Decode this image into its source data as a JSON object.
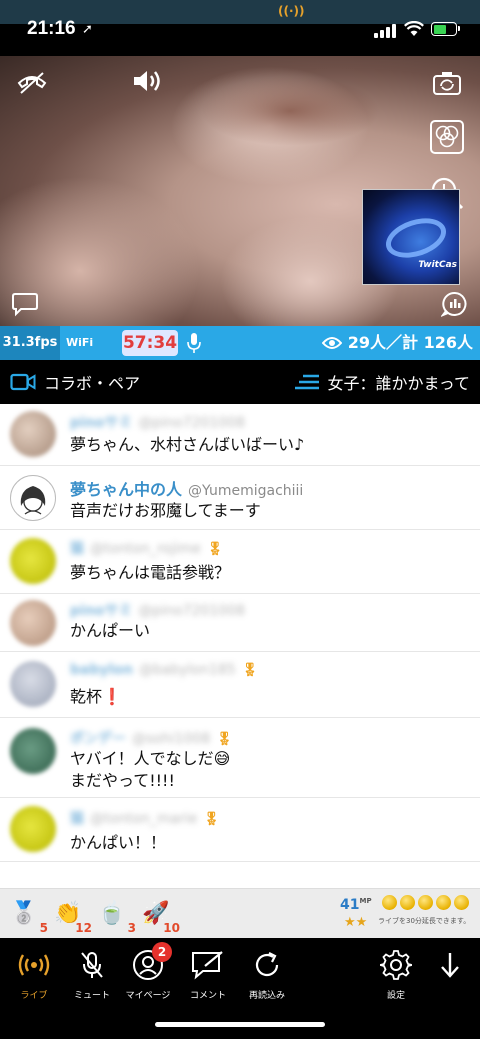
{
  "status_bar": {
    "time": "21:16",
    "location_icon": "location-arrow-icon",
    "live_indicator_icon": "broadcast-icon",
    "battery_color": "#39d353"
  },
  "video": {
    "icons": [
      "hangup-phone-icon",
      "speaker-icon",
      "camera-switch-icon",
      "filter-icon",
      "zoom-in-icon",
      "comment-toggle-icon",
      "stats-icon"
    ],
    "pip_brand": "TwitCas"
  },
  "info_bar": {
    "fps": "31.3fps",
    "network": "WiFi",
    "elapsed": "57:34",
    "viewers": "29人／計 126人",
    "accent": "#2aa8e6"
  },
  "tool_row": {
    "collab_label": "コラボ・ペア",
    "topic": "女子：誰かかまって"
  },
  "comments": [
    {
      "name": "pinoサミ",
      "handle": "@pino7201008",
      "text": "夢ちゃん、水村さんばいばーい♪",
      "blurred": true,
      "medal": false
    },
    {
      "name": "夢ちゃん中の人",
      "handle": "@Yumemigachiii",
      "text": "音声だけお邪魔してまーす",
      "blurred": false,
      "medal": false
    },
    {
      "name": "猫",
      "handle": "@tonton_rojime",
      "text": "夢ちゃんは電話参戦？",
      "blurred": true,
      "medal": true
    },
    {
      "name": "pinoサミ",
      "handle": "@pino7201008",
      "text": "かんぱーい",
      "blurred": true,
      "medal": false
    },
    {
      "name": "babylon",
      "handle": "@babylon185",
      "text": "乾杯❗",
      "blurred": true,
      "medal": true
    },
    {
      "name": "ポンデー",
      "handle": "@sohi1008",
      "text": "ヤバイ！人でなしだ😅\nまだやって!!!!",
      "blurred": true,
      "medal": true
    },
    {
      "name": "猫",
      "handle": "@tonton_marie",
      "text": "かんぱい！！",
      "blurred": true,
      "medal": true
    }
  ],
  "gift_bar": {
    "items": [
      {
        "icon": "silver-coin-icon",
        "count": "5"
      },
      {
        "icon": "clap-icon",
        "count": "12"
      },
      {
        "icon": "tea-icon",
        "count": "3"
      },
      {
        "icon": "rocket-icon",
        "count": "10"
      }
    ],
    "mp_value": "41",
    "mp_unit": "MP",
    "mp_stars": "★★",
    "coins_count": 5,
    "extend_note": "ライブを30分延長できます。"
  },
  "bottom_nav": {
    "items": [
      {
        "label": "ライブ",
        "icon": "broadcast-icon",
        "active": true
      },
      {
        "label": "ミュート",
        "icon": "mute-mic-icon"
      },
      {
        "label": "マイページ",
        "icon": "profile-icon",
        "badge": "2"
      },
      {
        "label": "コメント",
        "icon": "comment-edit-icon"
      },
      {
        "label": "再読込み",
        "icon": "reload-icon"
      },
      {
        "label": "設定",
        "icon": "gear-icon"
      },
      {
        "label": "",
        "icon": "down-arrow-icon"
      }
    ],
    "active_color": "#e6a12b",
    "badge_color": "#e5322d"
  }
}
